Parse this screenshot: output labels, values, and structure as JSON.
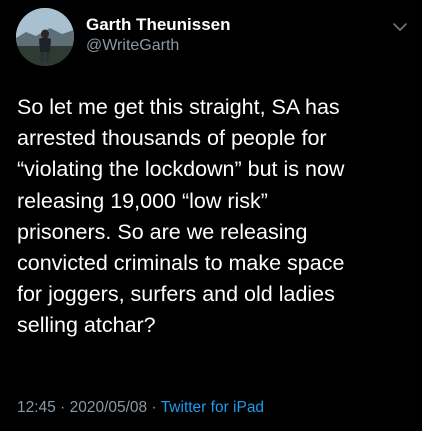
{
  "author": {
    "display_name": "Garth Theunissen",
    "handle": "@WriteGarth"
  },
  "tweet": {
    "lines": [
      "So let me get this straight, SA has",
      "arrested thousands of people for",
      "“violating the lockdown” but is now",
      "releasing 19,000 “low risk”",
      "prisoners. So are we releasing",
      "convicted criminals to make space",
      "for joggers, surfers and old ladies",
      "selling atchar?"
    ]
  },
  "meta": {
    "time": "12:45",
    "separator": "·",
    "date": "2020/05/08",
    "source": "Twitter for iPad"
  },
  "icons": {
    "menu": "chevron-down-icon"
  },
  "colors": {
    "background": "#000000",
    "text": "#ffffff",
    "secondary": "#8b98a5",
    "link": "#1d9bf0"
  }
}
